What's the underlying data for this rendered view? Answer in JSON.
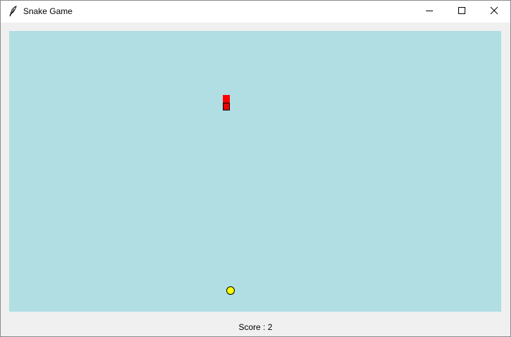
{
  "window": {
    "title": "Snake Game",
    "icon": "feather-icon",
    "controls": [
      "minimize-icon",
      "maximize-icon",
      "close-icon"
    ]
  },
  "game": {
    "board_color": "#b0dee3",
    "snake_color": "#ff0000",
    "food_color": "#ffff00",
    "score_label": "Score : 2"
  }
}
